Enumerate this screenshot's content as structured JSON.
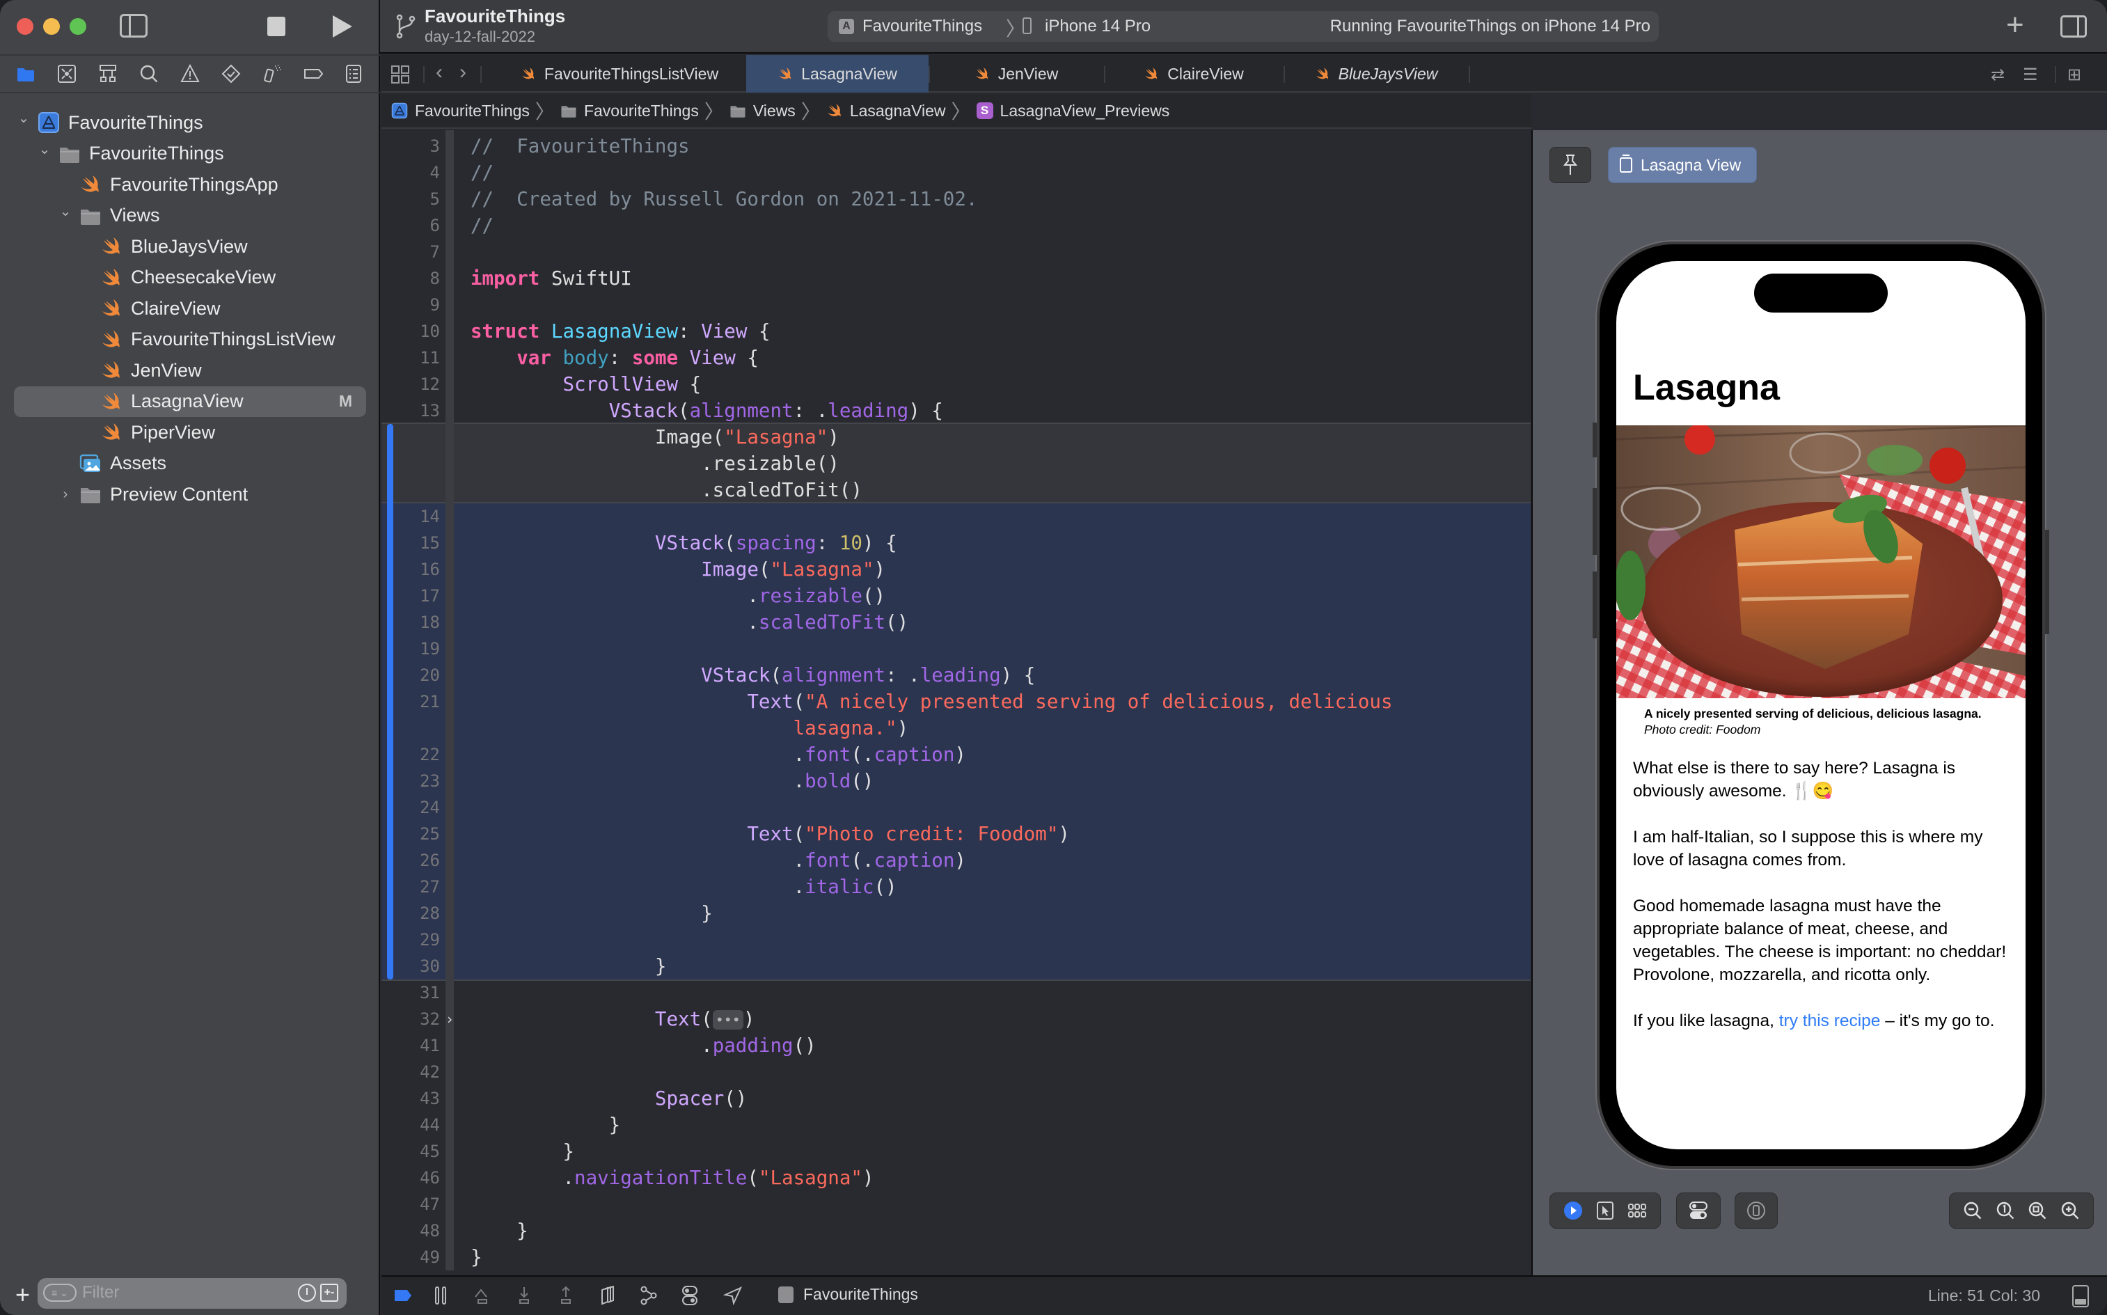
{
  "window": {
    "project_name": "FavouriteThings",
    "branch": "day-12-fall-2022"
  },
  "toolbar": {
    "scheme": "FavouriteThings",
    "device": "iPhone 14 Pro",
    "activity_status": "Running FavouriteThings on iPhone 14 Pro",
    "add_label": "+"
  },
  "navigator": {
    "tabs": [
      "project-navigator",
      "source-control-navigator",
      "symbol-navigator",
      "find-navigator",
      "issue-navigator",
      "test-navigator",
      "debug-navigator",
      "breakpoint-navigator",
      "report-navigator"
    ],
    "tree": [
      {
        "label": "FavouriteThings",
        "icon": "app-project-icon",
        "depth": 0,
        "disclosure": "open"
      },
      {
        "label": "FavouriteThings",
        "icon": "folder-icon",
        "depth": 1,
        "disclosure": "open"
      },
      {
        "label": "FavouriteThingsApp",
        "icon": "swift-file-icon",
        "depth": 2,
        "disclosure": ""
      },
      {
        "label": "Views",
        "icon": "folder-icon",
        "depth": 2,
        "disclosure": "open"
      },
      {
        "label": "BlueJaysView",
        "icon": "swift-file-icon",
        "depth": 3,
        "disclosure": ""
      },
      {
        "label": "CheesecakeView",
        "icon": "swift-file-icon",
        "depth": 3,
        "disclosure": ""
      },
      {
        "label": "ClaireView",
        "icon": "swift-file-icon",
        "depth": 3,
        "disclosure": ""
      },
      {
        "label": "FavouriteThingsListView",
        "icon": "swift-file-icon",
        "depth": 3,
        "disclosure": ""
      },
      {
        "label": "JenView",
        "icon": "swift-file-icon",
        "depth": 3,
        "disclosure": ""
      },
      {
        "label": "LasagnaView",
        "icon": "swift-file-icon",
        "depth": 3,
        "disclosure": "",
        "selected": true,
        "badge": "M"
      },
      {
        "label": "PiperView",
        "icon": "swift-file-icon",
        "depth": 3,
        "disclosure": ""
      },
      {
        "label": "Assets",
        "icon": "asset-catalog-icon",
        "depth": 2,
        "disclosure": ""
      },
      {
        "label": "Preview Content",
        "icon": "folder-icon",
        "depth": 2,
        "disclosure": "closed"
      }
    ],
    "filter_placeholder": "Filter"
  },
  "tabs": [
    {
      "label": "FavouriteThingsListView",
      "active": false,
      "italic": false
    },
    {
      "label": "LasagnaView",
      "active": true,
      "italic": false
    },
    {
      "label": "JenView",
      "active": false,
      "italic": false
    },
    {
      "label": "ClaireView",
      "active": false,
      "italic": false
    },
    {
      "label": "BlueJaysView",
      "active": false,
      "italic": true
    }
  ],
  "breadcrumb": [
    {
      "label": "FavouriteThings",
      "icon": "app-project-icon"
    },
    {
      "label": "FavouriteThings",
      "icon": "folder-icon"
    },
    {
      "label": "Views",
      "icon": "folder-icon"
    },
    {
      "label": "LasagnaView",
      "icon": "swift-file-icon"
    },
    {
      "label": "LasagnaView_Previews",
      "icon": "struct-icon",
      "icon_text": "S"
    }
  ],
  "editor": {
    "lines": [
      {
        "n": "3",
        "tokens": [
          [
            "cmt",
            "//  FavouriteThings"
          ]
        ]
      },
      {
        "n": "4",
        "tokens": [
          [
            "cmt",
            "//"
          ]
        ]
      },
      {
        "n": "5",
        "tokens": [
          [
            "cmt",
            "//  Created by Russell Gordon on 2021-11-02."
          ]
        ]
      },
      {
        "n": "6",
        "tokens": [
          [
            "cmt",
            "//"
          ]
        ]
      },
      {
        "n": "7",
        "tokens": []
      },
      {
        "n": "8",
        "tokens": [
          [
            "kw",
            "import"
          ],
          [
            "pl",
            " SwiftUI"
          ]
        ]
      },
      {
        "n": "9",
        "tokens": []
      },
      {
        "n": "10",
        "tokens": [
          [
            "kw",
            "struct"
          ],
          [
            "pl",
            " "
          ],
          [
            "decl",
            "LasagnaView"
          ],
          [
            "pl",
            ": "
          ],
          [
            "type",
            "View"
          ],
          [
            "pl",
            " {"
          ]
        ]
      },
      {
        "n": "11",
        "tokens": [
          [
            "pl",
            "    "
          ],
          [
            "kw",
            "var"
          ],
          [
            "pl",
            " "
          ],
          [
            "var",
            "body"
          ],
          [
            "pl",
            ": "
          ],
          [
            "kw",
            "some"
          ],
          [
            "pl",
            " "
          ],
          [
            "type",
            "View"
          ],
          [
            "pl",
            " {"
          ]
        ]
      },
      {
        "n": "12",
        "tokens": [
          [
            "pl",
            "        "
          ],
          [
            "type",
            "ScrollView"
          ],
          [
            "pl",
            " {"
          ]
        ]
      },
      {
        "n": "13",
        "tokens": [
          [
            "pl",
            "            "
          ],
          [
            "type",
            "VStack"
          ],
          [
            "pl",
            "("
          ],
          [
            "prop",
            "alignment"
          ],
          [
            "pl",
            ": ."
          ],
          [
            "prop",
            "leading"
          ],
          [
            "pl",
            ") {"
          ]
        ]
      },
      {
        "n": "",
        "region": "old",
        "tokens": [
          [
            "pl",
            "                Image("
          ],
          [
            "str",
            "\"Lasagna\""
          ],
          [
            "pl",
            ")"
          ]
        ]
      },
      {
        "n": "",
        "region": "old",
        "tokens": [
          [
            "pl",
            "                    .resizable()"
          ]
        ]
      },
      {
        "n": "",
        "region": "old",
        "tokens": [
          [
            "pl",
            "                    .scaledToFit()"
          ]
        ]
      },
      {
        "n": "14",
        "region": "new",
        "tokens": []
      },
      {
        "n": "15",
        "region": "new",
        "tokens": [
          [
            "pl",
            "                "
          ],
          [
            "type",
            "VStack"
          ],
          [
            "pl",
            "("
          ],
          [
            "prop",
            "spacing"
          ],
          [
            "pl",
            ": "
          ],
          [
            "num",
            "10"
          ],
          [
            "pl",
            ") {"
          ]
        ]
      },
      {
        "n": "16",
        "region": "new",
        "tokens": [
          [
            "pl",
            "                    "
          ],
          [
            "type",
            "Image"
          ],
          [
            "pl",
            "("
          ],
          [
            "str",
            "\"Lasagna\""
          ],
          [
            "pl",
            ")"
          ]
        ]
      },
      {
        "n": "17",
        "region": "new",
        "tokens": [
          [
            "pl",
            "                        ."
          ],
          [
            "prop",
            "resizable"
          ],
          [
            "pl",
            "()"
          ]
        ]
      },
      {
        "n": "18",
        "region": "new",
        "tokens": [
          [
            "pl",
            "                        ."
          ],
          [
            "prop",
            "scaledToFit"
          ],
          [
            "pl",
            "()"
          ]
        ]
      },
      {
        "n": "19",
        "region": "new",
        "tokens": []
      },
      {
        "n": "20",
        "region": "new",
        "tokens": [
          [
            "pl",
            "                    "
          ],
          [
            "type",
            "VStack"
          ],
          [
            "pl",
            "("
          ],
          [
            "prop",
            "alignment"
          ],
          [
            "pl",
            ": ."
          ],
          [
            "prop",
            "leading"
          ],
          [
            "pl",
            ") {"
          ]
        ]
      },
      {
        "n": "21",
        "region": "new",
        "tokens": [
          [
            "pl",
            "                        "
          ],
          [
            "type",
            "Text"
          ],
          [
            "pl",
            "("
          ],
          [
            "str",
            "\"A nicely presented serving of delicious, delicious"
          ]
        ]
      },
      {
        "n": "",
        "region": "new",
        "tokens": [
          [
            "pl",
            "                            "
          ],
          [
            "str",
            "lasagna.\""
          ],
          [
            "pl",
            ")"
          ]
        ]
      },
      {
        "n": "22",
        "region": "new",
        "tokens": [
          [
            "pl",
            "                            ."
          ],
          [
            "prop",
            "font"
          ],
          [
            "pl",
            "(."
          ],
          [
            "prop",
            "caption"
          ],
          [
            "pl",
            ")"
          ]
        ]
      },
      {
        "n": "23",
        "region": "new",
        "tokens": [
          [
            "pl",
            "                            ."
          ],
          [
            "prop",
            "bold"
          ],
          [
            "pl",
            "()"
          ]
        ]
      },
      {
        "n": "24",
        "region": "new",
        "tokens": []
      },
      {
        "n": "25",
        "region": "new",
        "tokens": [
          [
            "pl",
            "                        "
          ],
          [
            "type",
            "Text"
          ],
          [
            "pl",
            "("
          ],
          [
            "str",
            "\"Photo credit: Foodom\""
          ],
          [
            "pl",
            ")"
          ]
        ]
      },
      {
        "n": "26",
        "region": "new",
        "tokens": [
          [
            "pl",
            "                            ."
          ],
          [
            "prop",
            "font"
          ],
          [
            "pl",
            "(."
          ],
          [
            "prop",
            "caption"
          ],
          [
            "pl",
            ")"
          ]
        ]
      },
      {
        "n": "27",
        "region": "new",
        "tokens": [
          [
            "pl",
            "                            ."
          ],
          [
            "prop",
            "italic"
          ],
          [
            "pl",
            "()"
          ]
        ]
      },
      {
        "n": "28",
        "region": "new",
        "tokens": [
          [
            "pl",
            "                    }"
          ]
        ]
      },
      {
        "n": "29",
        "region": "new",
        "tokens": []
      },
      {
        "n": "30",
        "region": "new",
        "tokens": [
          [
            "pl",
            "                }"
          ]
        ]
      },
      {
        "n": "31",
        "tokens": []
      },
      {
        "n": "32",
        "folded": true,
        "tokens": [
          [
            "pl",
            "                "
          ],
          [
            "type",
            "Text"
          ],
          [
            "pl",
            "("
          ],
          [
            "fold",
            "•••"
          ],
          [
            "pl",
            ")"
          ]
        ]
      },
      {
        "n": "41",
        "tokens": [
          [
            "pl",
            "                    ."
          ],
          [
            "prop",
            "padding"
          ],
          [
            "pl",
            "()"
          ]
        ]
      },
      {
        "n": "42",
        "tokens": []
      },
      {
        "n": "43",
        "tokens": [
          [
            "pl",
            "                "
          ],
          [
            "type",
            "Spacer"
          ],
          [
            "pl",
            "()"
          ]
        ]
      },
      {
        "n": "44",
        "tokens": [
          [
            "pl",
            "            }"
          ]
        ]
      },
      {
        "n": "45",
        "tokens": [
          [
            "pl",
            "        }"
          ]
        ]
      },
      {
        "n": "46",
        "tokens": [
          [
            "pl",
            "        ."
          ],
          [
            "prop",
            "navigationTitle"
          ],
          [
            "pl",
            "("
          ],
          [
            "str",
            "\"Lasagna\""
          ],
          [
            "pl",
            ")"
          ]
        ]
      },
      {
        "n": "47",
        "tokens": []
      },
      {
        "n": "48",
        "tokens": [
          [
            "pl",
            "    }"
          ]
        ]
      },
      {
        "n": "49",
        "tokens": [
          [
            "pl",
            "}"
          ]
        ]
      }
    ]
  },
  "canvas": {
    "preview_name": "Lasagna View",
    "app": {
      "nav_title": "Lasagna",
      "caption_bold": "A nicely presented serving of delicious, delicious lasagna.",
      "caption_italic": "Photo credit: Foodom",
      "paragraphs": [
        {
          "text": "What else is there to say here? Lasagna is obviously awesome. 🍴😋"
        },
        {
          "text": "I am half-Italian, so I suppose this is where my love of lasagna comes from."
        },
        {
          "text": "Good homemade lasagna must have the appropriate balance of meat, cheese, and vegetables. The cheese is important: no cheddar! Provolone, mozzarella, and ricotta only."
        }
      ],
      "link_paragraph": {
        "before": "If you like lasagna, ",
        "link": "try this recipe",
        "after": " – it's my go to."
      }
    },
    "controls": {
      "mode_group": [
        "live-mode-icon",
        "selectable-mode-icon",
        "variants-icon"
      ],
      "settings": "device-settings-icon",
      "device": "device-icon",
      "zoom_group": [
        "zoom-out-icon",
        "zoom-actual-size-icon",
        "zoom-to-fit-icon",
        "zoom-in-icon"
      ]
    }
  },
  "statusbar": {
    "scheme": "FavouriteThings",
    "position": "Line: 51  Col: 30"
  },
  "colors": {
    "accent": "#3478f6",
    "selected_tab": "#384c6e",
    "swift_orange": "#f08a3a",
    "link": "#2f7cf6"
  }
}
